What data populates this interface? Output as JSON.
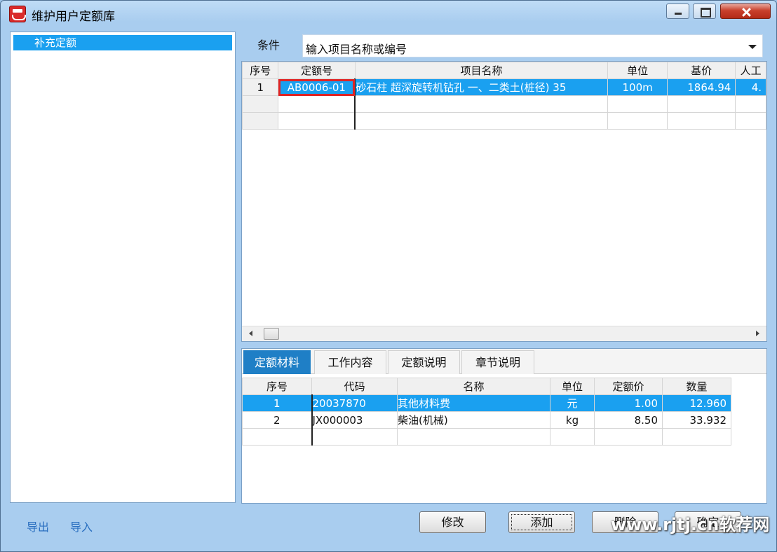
{
  "window": {
    "title": "维护用户定额库"
  },
  "tree": {
    "selected_node": "补充定额"
  },
  "filter": {
    "label": "条件",
    "value": "输入项目名称或编号"
  },
  "quota_table": {
    "columns": [
      "序号",
      "定额号",
      "项目名称",
      "单位",
      "基价",
      "人工"
    ],
    "rows": [
      {
        "index": "1",
        "code": "AB0006-01",
        "name": "砂石柱 超深旋转机钻孔 一、二类土(桩径) 35",
        "unit": "100m",
        "base_price": "1864.94",
        "labor": "4."
      }
    ]
  },
  "tabs": [
    "定额材料",
    "工作内容",
    "定额说明",
    "章节说明"
  ],
  "material_table": {
    "columns": [
      "序号",
      "代码",
      "名称",
      "单位",
      "定额价",
      "数量"
    ],
    "rows": [
      {
        "index": "1",
        "code": "20037870",
        "name": "其他材料费",
        "unit": "元",
        "price": "1.00",
        "qty": "12.960"
      },
      {
        "index": "2",
        "code": "JX000003",
        "name": "柴油(机械)",
        "unit": "kg",
        "price": "8.50",
        "qty": "33.932"
      }
    ]
  },
  "footer": {
    "export_label": "导出",
    "import_label": "导入",
    "modify_label": "修改",
    "add_label": "添加",
    "delete_label": "删除",
    "confirm_label": "确定"
  },
  "watermark": "www.rjtj.cn软荐网",
  "colors": {
    "selection": "#1aa0f0",
    "active_tab": "#1f7fc6",
    "highlight_border": "#e02424"
  }
}
